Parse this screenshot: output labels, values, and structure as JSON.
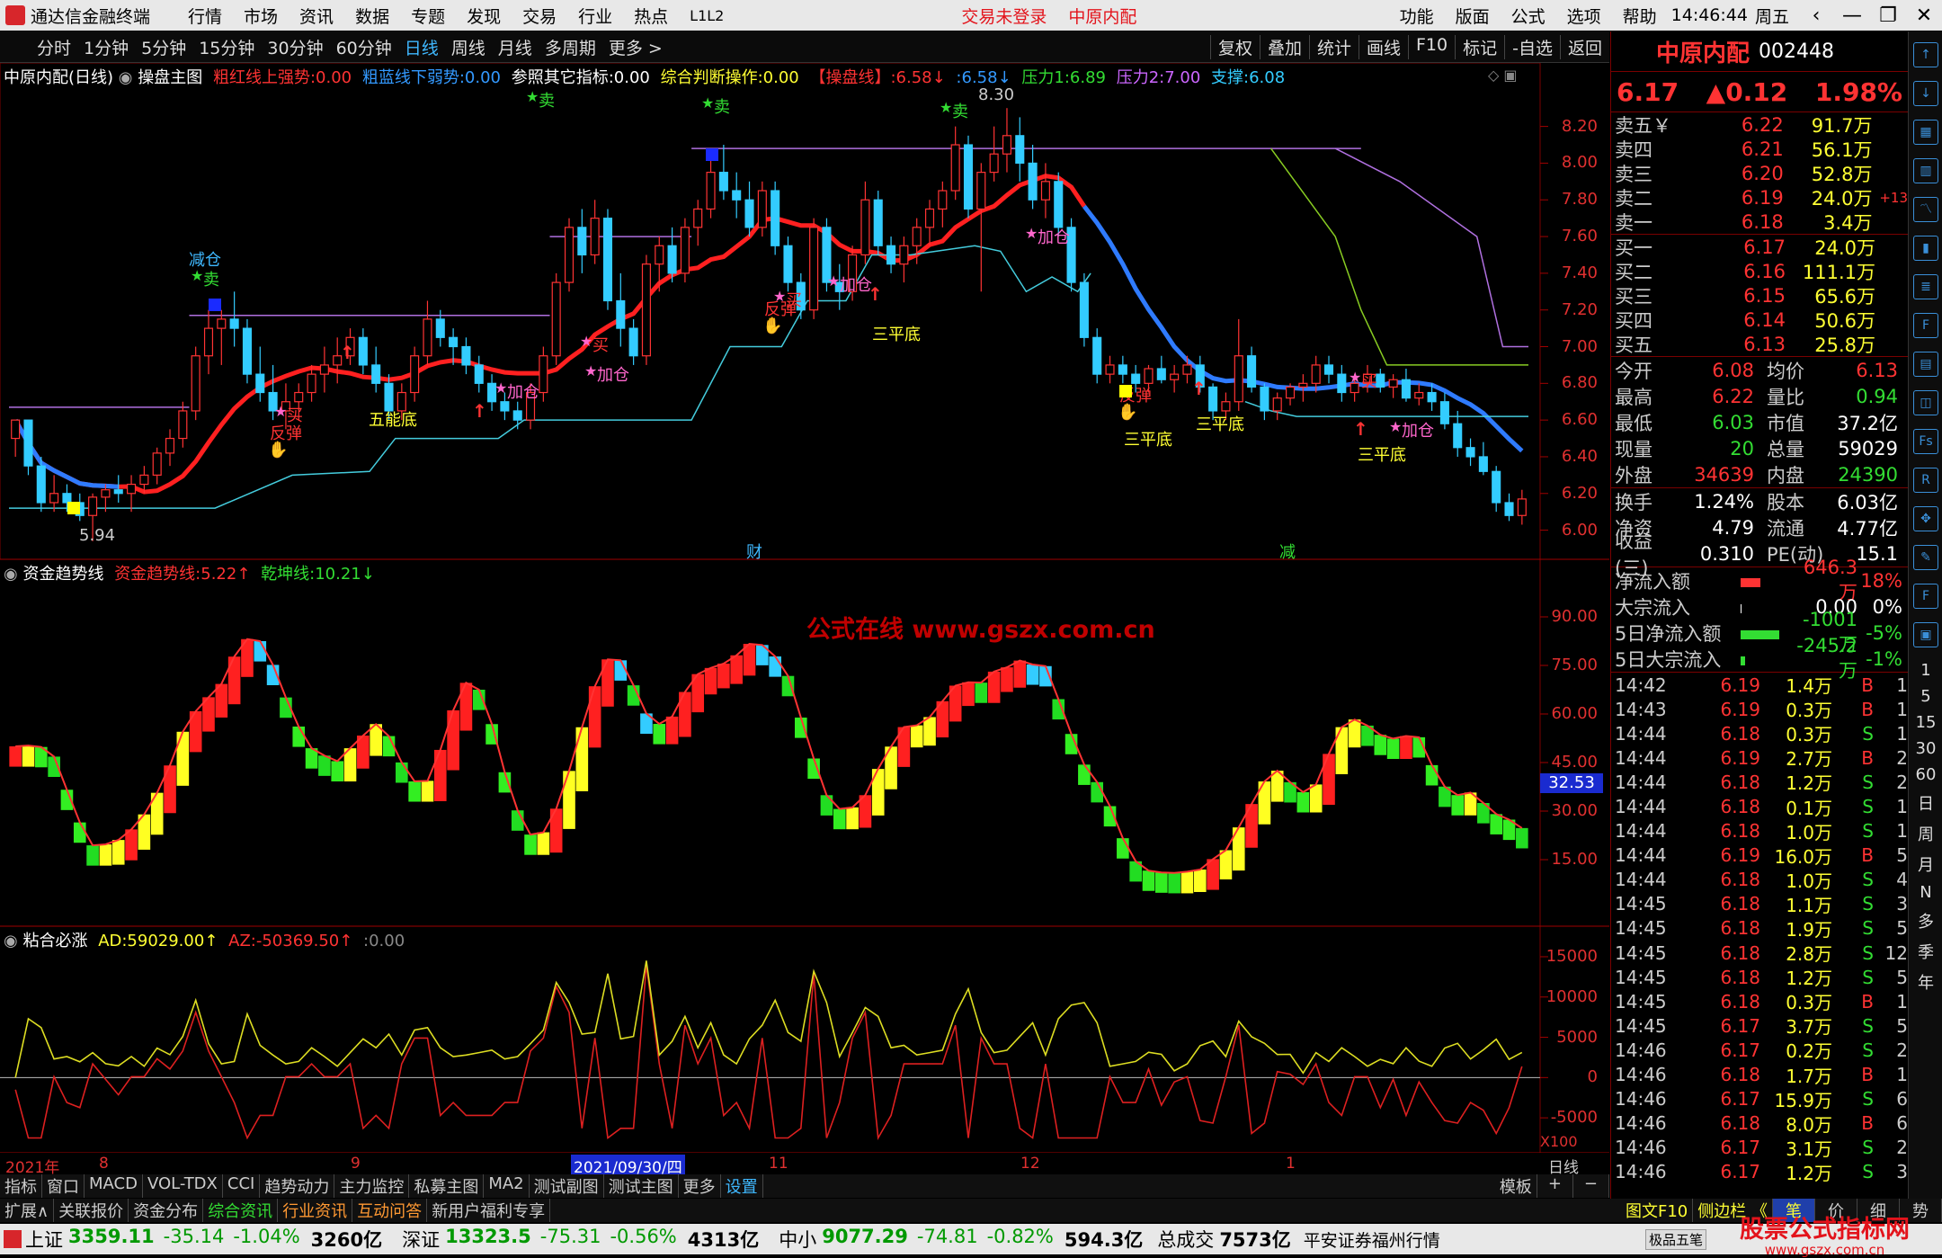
{
  "menubar": {
    "app_title": "通达信金融终端",
    "items": [
      "行情",
      "市场",
      "资讯",
      "数据",
      "专题",
      "发现",
      "交易",
      "行业",
      "热点",
      "L1L2"
    ],
    "trade_status": "交易未登录",
    "stock_name": "中原内配",
    "right_items": [
      "功能",
      "版面",
      "公式",
      "选项",
      "帮助"
    ],
    "time": "14:46:44",
    "weekday": "周五"
  },
  "periodbar": {
    "periods": [
      "分时",
      "1分钟",
      "5分钟",
      "15分钟",
      "30分钟",
      "60分钟",
      "日线",
      "周线",
      "月线",
      "多周期",
      "更多 >"
    ],
    "selected": "日线",
    "tools": [
      "复权",
      "叠加",
      "统计",
      "画线",
      "F10",
      "标记",
      "-自选",
      "返回"
    ]
  },
  "main_legend": {
    "title": "中原内配(日线)",
    "indicator": "操盘主图",
    "items": [
      {
        "label": "粗红线上强势:",
        "value": "0.00",
        "color": "#ff3333"
      },
      {
        "label": "粗蓝线下弱势:",
        "value": "0.00",
        "color": "#3399ff"
      },
      {
        "label": "参照其它指标:",
        "value": "0.00",
        "color": "#ffffff"
      },
      {
        "label": "综合判断操作:",
        "value": "0.00",
        "color": "#ffff33"
      },
      {
        "label": "【操盘线】:",
        "value": "6.58↓",
        "color": "#ff3333"
      },
      {
        "label": ":",
        "value": "6.58↓",
        "color": "#3399ff"
      },
      {
        "label": "压力1:",
        "value": "6.89",
        "color": "#33dd33"
      },
      {
        "label": "压力2:",
        "value": "7.00",
        "color": "#cc66ff"
      },
      {
        "label": "支撑:",
        "value": "6.08",
        "color": "#33ccff"
      }
    ]
  },
  "main_axis": [
    "8.20",
    "8.00",
    "7.80",
    "7.60",
    "7.40",
    "7.20",
    "7.00",
    "6.80",
    "6.60",
    "6.40",
    "6.20",
    "6.00"
  ],
  "annotations": {
    "high": "8.30",
    "low": "5.94",
    "sell": "卖",
    "buy": "买",
    "reduce": "减仓",
    "add": "加仓",
    "rebound": "反弹",
    "triple_bottom": "三平底",
    "wu_bottom": "五能底",
    "cai": "财",
    "jian": "减"
  },
  "sub1": {
    "title": "资金趋势线",
    "items": [
      {
        "label": "资金趋势线:",
        "value": "5.22↑",
        "color": "#ff3333"
      },
      {
        "label": "乾坤线:",
        "value": "10.21↓",
        "color": "#33dd33"
      }
    ],
    "axis": [
      "90.00",
      "75.00",
      "60.00",
      "45.00",
      "30.00",
      "15.00"
    ],
    "current": "32.53",
    "watermark": "公式在线 www.gszx.com.cn"
  },
  "sub2": {
    "title": "粘合必涨",
    "items": [
      {
        "label": "AD:",
        "value": "59029.00↑",
        "color": "#ffff33"
      },
      {
        "label": "AZ:",
        "value": "-50369.50↑",
        "color": "#ff3333"
      },
      {
        "label": ":",
        "value": "0.00",
        "color": "#888888"
      }
    ],
    "axis": [
      "15000",
      "10000",
      "5000",
      "0",
      "-5000"
    ],
    "scale": "X100"
  },
  "time_axis": {
    "labels": [
      "2021年",
      "8",
      "9",
      "2021/09/30/四",
      "11",
      "12",
      "1"
    ],
    "period": "日线"
  },
  "tabs1": {
    "items": [
      "指标",
      "窗口",
      "MACD",
      "VOL-TDX",
      "CCI",
      "趋势动力",
      "主力监控",
      "私募主图",
      "MA2",
      "测试副图",
      "测试主图",
      "更多",
      "设置"
    ],
    "active": "设置",
    "right": [
      "模板",
      "+",
      "−"
    ]
  },
  "tabs2": {
    "items": [
      {
        "label": "扩展∧",
        "color": "w"
      },
      {
        "label": "关联报价",
        "color": "w"
      },
      {
        "label": "资金分布",
        "color": "w"
      },
      {
        "label": "综合资讯",
        "color": "g"
      },
      {
        "label": "行业资讯",
        "color": "o"
      },
      {
        "label": "互动问答",
        "color": "o"
      },
      {
        "label": "新用户福利专享",
        "color": "w"
      }
    ],
    "right": [
      "图文F10",
      "侧边栏 《",
      "笔",
      "价",
      "细",
      "势"
    ]
  },
  "status": {
    "indices": [
      {
        "name": "上证",
        "value": "3359.11",
        "chg": "-35.14",
        "pct": "-1.04%",
        "amt": "3260亿"
      },
      {
        "name": "深证",
        "value": "13323.5",
        "chg": "-75.31",
        "pct": "-0.56%",
        "amt": "4313亿"
      },
      {
        "name": "中小",
        "value": "9077.29",
        "chg": "-74.81",
        "pct": "-0.82%",
        "amt": "594.3亿"
      }
    ],
    "total_label": "总成交",
    "total_value": "7573亿",
    "broker": "平安证券福州行情",
    "badge": "极品五笔",
    "watermark": "股票公式指标网",
    "watermark_url": "www.gszx.com.cn"
  },
  "quote": {
    "name": "中原内配",
    "code": "002448",
    "price": "6.17",
    "change": "▲0.12",
    "pct": "1.98%",
    "asks": [
      {
        "label": "卖五￥",
        "price": "6.22",
        "vol": "91.7万",
        "extra": ""
      },
      {
        "label": "卖四",
        "price": "6.21",
        "vol": "56.1万",
        "extra": ""
      },
      {
        "label": "卖三",
        "price": "6.20",
        "vol": "52.8万",
        "extra": ""
      },
      {
        "label": "卖二",
        "price": "6.19",
        "vol": "24.0万",
        "extra": "+13"
      },
      {
        "label": "卖一",
        "price": "6.18",
        "vol": "3.4万",
        "extra": ""
      }
    ],
    "bids": [
      {
        "label": "买一",
        "price": "6.17",
        "vol": "24.0万"
      },
      {
        "label": "买二",
        "price": "6.16",
        "vol": "111.1万"
      },
      {
        "label": "买三",
        "price": "6.15",
        "vol": "65.6万"
      },
      {
        "label": "买四",
        "price": "6.14",
        "vol": "50.6万"
      },
      {
        "label": "买五",
        "price": "6.13",
        "vol": "25.8万"
      }
    ],
    "stats": [
      {
        "l": "今开",
        "v": "6.08",
        "vc": "up",
        "l2": "均价",
        "v2": "6.13",
        "v2c": "up"
      },
      {
        "l": "最高",
        "v": "6.22",
        "vc": "up",
        "l2": "量比",
        "v2": "0.94",
        "v2c": "dn"
      },
      {
        "l": "最低",
        "v": "6.03",
        "vc": "dn",
        "l2": "市值",
        "v2": "37.2亿",
        "v2c": "w"
      },
      {
        "l": "现量",
        "v": "20",
        "vc": "dn",
        "l2": "总量",
        "v2": "59029",
        "v2c": "w"
      },
      {
        "l": "外盘",
        "v": "34639",
        "vc": "up",
        "l2": "内盘",
        "v2": "24390",
        "v2c": "dn"
      }
    ],
    "stats2": [
      {
        "l": "换手",
        "v": "1.24%",
        "l2": "股本",
        "v2": "6.03亿"
      },
      {
        "l": "净资",
        "v": "4.79",
        "l2": "流通",
        "v2": "4.77亿"
      },
      {
        "l": "收益(三)",
        "v": "0.310",
        "l2": "PE(动)",
        "v2": "15.1"
      }
    ],
    "flows": [
      {
        "l": "净流入额",
        "v": "646.3万",
        "p": "18%",
        "c": "up",
        "bar": 0.45
      },
      {
        "l": "大宗流入",
        "v": "0.00",
        "p": "0%",
        "c": "w",
        "bar": 0.02
      },
      {
        "l": "5日净流入额",
        "v": "-1001万",
        "p": "-5%",
        "c": "dn",
        "bar": 0.9
      },
      {
        "l": "5日大宗流入",
        "v": "-245.2万",
        "p": "-1%",
        "c": "dn",
        "bar": 0.1
      }
    ],
    "ticks": [
      [
        "14:42",
        "6.19",
        "1.4万",
        "B",
        "1"
      ],
      [
        "14:43",
        "6.19",
        "0.3万",
        "B",
        "1"
      ],
      [
        "14:44",
        "6.18",
        "0.3万",
        "S",
        "1"
      ],
      [
        "14:44",
        "6.19",
        "2.7万",
        "B",
        "2"
      ],
      [
        "14:44",
        "6.18",
        "1.2万",
        "S",
        "2"
      ],
      [
        "14:44",
        "6.18",
        "0.1万",
        "S",
        "1"
      ],
      [
        "14:44",
        "6.18",
        "1.0万",
        "S",
        "1"
      ],
      [
        "14:44",
        "6.19",
        "16.0万",
        "B",
        "5"
      ],
      [
        "14:44",
        "6.18",
        "1.0万",
        "S",
        "4"
      ],
      [
        "14:45",
        "6.18",
        "1.1万",
        "S",
        "3"
      ],
      [
        "14:45",
        "6.18",
        "1.9万",
        "S",
        "5"
      ],
      [
        "14:45",
        "6.18",
        "2.8万",
        "S",
        "12"
      ],
      [
        "14:45",
        "6.18",
        "1.2万",
        "S",
        "5"
      ],
      [
        "14:45",
        "6.18",
        "0.3万",
        "B",
        "1"
      ],
      [
        "14:45",
        "6.17",
        "3.7万",
        "S",
        "5"
      ],
      [
        "14:46",
        "6.17",
        "0.2万",
        "S",
        "2"
      ],
      [
        "14:46",
        "6.18",
        "1.7万",
        "B",
        "1"
      ],
      [
        "14:46",
        "6.17",
        "15.9万",
        "S",
        "6"
      ],
      [
        "14:46",
        "6.18",
        "8.0万",
        "B",
        "6"
      ],
      [
        "14:46",
        "6.17",
        "3.1万",
        "S",
        "2"
      ],
      [
        "14:46",
        "6.17",
        "1.2万",
        "S",
        "3"
      ]
    ]
  },
  "side_icons": [
    "arrow-up-icon",
    "arrow-down-icon",
    "grid-icon",
    "bars-icon",
    "line-icon",
    "candle-icon",
    "list-icon",
    "f10-icon",
    "news-icon",
    "chip-icon",
    "fs-icon",
    "rsi-icon",
    "move-icon",
    "pen-icon",
    "fs2-icon",
    "box-icon"
  ],
  "side_text": [
    "1",
    "5",
    "15",
    "30",
    "60",
    "日",
    "周",
    "月",
    "N",
    "多",
    "季",
    "年"
  ],
  "colors": {
    "up": "#ff3333",
    "down": "#33ccff",
    "ma_red": "#ff2020",
    "ma_blue": "#2f7bff",
    "bg": "#000000",
    "grid": "#7a0000"
  },
  "chart_data": {
    "type": "candlestick",
    "dates_note": "2021年7月–2022年1月 日线",
    "ylim": [
      5.9,
      8.35
    ],
    "candles": [
      [
        6.5,
        6.6,
        6.4,
        6.6
      ],
      [
        6.6,
        6.6,
        6.3,
        6.35
      ],
      [
        6.35,
        6.4,
        6.1,
        6.15
      ],
      [
        6.15,
        6.3,
        6.1,
        6.2
      ],
      [
        6.2,
        6.25,
        6.1,
        6.15
      ],
      [
        6.15,
        6.2,
        6.05,
        6.08
      ],
      [
        6.08,
        6.2,
        5.94,
        6.18
      ],
      [
        6.18,
        6.25,
        6.1,
        6.22
      ],
      [
        6.22,
        6.3,
        6.15,
        6.2
      ],
      [
        6.2,
        6.3,
        6.1,
        6.25
      ],
      [
        6.25,
        6.35,
        6.2,
        6.3
      ],
      [
        6.3,
        6.45,
        6.25,
        6.42
      ],
      [
        6.42,
        6.55,
        6.35,
        6.5
      ],
      [
        6.5,
        6.7,
        6.45,
        6.65
      ],
      [
        6.65,
        7.0,
        6.6,
        6.95
      ],
      [
        6.95,
        7.2,
        6.85,
        7.1
      ],
      [
        7.1,
        7.2,
        6.9,
        7.15
      ],
      [
        7.15,
        7.3,
        7.0,
        7.1
      ],
      [
        7.1,
        7.15,
        6.8,
        6.85
      ],
      [
        6.85,
        7.0,
        6.7,
        6.75
      ],
      [
        6.75,
        6.9,
        6.6,
        6.65
      ],
      [
        6.65,
        6.8,
        6.55,
        6.7
      ],
      [
        6.7,
        6.8,
        6.6,
        6.75
      ],
      [
        6.75,
        6.9,
        6.7,
        6.85
      ],
      [
        6.85,
        7.0,
        6.75,
        6.9
      ],
      [
        6.9,
        7.05,
        6.8,
        6.95
      ],
      [
        6.95,
        7.1,
        6.9,
        7.05
      ],
      [
        7.05,
        7.1,
        6.85,
        6.9
      ],
      [
        6.9,
        7.0,
        6.75,
        6.8
      ],
      [
        6.8,
        6.85,
        6.6,
        6.65
      ],
      [
        6.65,
        6.8,
        6.6,
        6.75
      ],
      [
        6.75,
        7.0,
        6.7,
        6.95
      ],
      [
        6.95,
        7.25,
        6.9,
        7.15
      ],
      [
        7.15,
        7.2,
        7.0,
        7.05
      ],
      [
        7.05,
        7.1,
        6.9,
        7.0
      ],
      [
        7.0,
        7.05,
        6.85,
        6.9
      ],
      [
        6.9,
        6.95,
        6.75,
        6.8
      ],
      [
        6.8,
        6.85,
        6.65,
        6.7
      ],
      [
        6.7,
        6.75,
        6.6,
        6.65
      ],
      [
        6.65,
        6.7,
        6.55,
        6.6
      ],
      [
        6.6,
        6.8,
        6.55,
        6.75
      ],
      [
        6.75,
        7.0,
        6.7,
        6.95
      ],
      [
        6.95,
        7.4,
        6.9,
        7.35
      ],
      [
        7.35,
        7.7,
        7.3,
        7.65
      ],
      [
        7.65,
        7.75,
        7.4,
        7.5
      ],
      [
        7.5,
        7.8,
        7.45,
        7.7
      ],
      [
        7.7,
        7.75,
        7.2,
        7.25
      ],
      [
        7.25,
        7.4,
        7.0,
        7.1
      ],
      [
        7.1,
        7.15,
        6.9,
        6.95
      ],
      [
        6.95,
        7.5,
        6.9,
        7.45
      ],
      [
        7.45,
        7.6,
        7.3,
        7.55
      ],
      [
        7.55,
        7.65,
        7.35,
        7.4
      ],
      [
        7.4,
        7.7,
        7.35,
        7.65
      ],
      [
        7.65,
        7.8,
        7.55,
        7.75
      ],
      [
        7.75,
        8.05,
        7.7,
        7.95
      ],
      [
        7.95,
        8.1,
        7.8,
        7.85
      ],
      [
        7.85,
        7.95,
        7.7,
        7.8
      ],
      [
        7.8,
        7.9,
        7.6,
        7.65
      ],
      [
        7.65,
        7.9,
        7.6,
        7.85
      ],
      [
        7.85,
        7.9,
        7.5,
        7.55
      ],
      [
        7.55,
        7.6,
        7.3,
        7.35
      ],
      [
        7.35,
        7.4,
        7.15,
        7.2
      ],
      [
        7.2,
        7.7,
        7.15,
        7.65
      ],
      [
        7.65,
        7.7,
        7.3,
        7.35
      ],
      [
        7.35,
        7.45,
        7.2,
        7.3
      ],
      [
        7.3,
        7.55,
        7.25,
        7.5
      ],
      [
        7.5,
        7.9,
        7.45,
        7.8
      ],
      [
        7.8,
        7.85,
        7.5,
        7.55
      ],
      [
        7.55,
        7.6,
        7.4,
        7.45
      ],
      [
        7.45,
        7.6,
        7.35,
        7.55
      ],
      [
        7.55,
        7.7,
        7.45,
        7.65
      ],
      [
        7.65,
        7.8,
        7.55,
        7.75
      ],
      [
        7.75,
        7.9,
        7.65,
        7.85
      ],
      [
        7.85,
        8.2,
        7.8,
        8.1
      ],
      [
        8.1,
        8.15,
        7.7,
        7.75
      ],
      [
        7.75,
        8.0,
        7.3,
        7.95
      ],
      [
        7.95,
        8.2,
        7.9,
        8.05
      ],
      [
        8.05,
        8.3,
        7.95,
        8.15
      ],
      [
        8.15,
        8.25,
        7.9,
        8.0
      ],
      [
        8.0,
        8.1,
        7.75,
        7.8
      ],
      [
        7.8,
        8.0,
        7.7,
        7.9
      ],
      [
        7.9,
        7.95,
        7.6,
        7.65
      ],
      [
        7.65,
        7.7,
        7.3,
        7.35
      ],
      [
        7.35,
        7.4,
        7.0,
        7.05
      ],
      [
        7.05,
        7.1,
        6.8,
        6.85
      ],
      [
        6.85,
        6.95,
        6.8,
        6.9
      ],
      [
        6.9,
        6.95,
        6.8,
        6.85
      ],
      [
        6.85,
        6.9,
        6.75,
        6.8
      ],
      [
        6.8,
        6.9,
        6.75,
        6.88
      ],
      [
        6.88,
        6.95,
        6.8,
        6.82
      ],
      [
        6.82,
        6.9,
        6.75,
        6.85
      ],
      [
        6.85,
        6.95,
        6.8,
        6.9
      ],
      [
        6.9,
        6.95,
        6.75,
        6.78
      ],
      [
        6.78,
        6.8,
        6.6,
        6.65
      ],
      [
        6.65,
        6.75,
        6.6,
        6.7
      ],
      [
        6.7,
        7.15,
        6.65,
        6.95
      ],
      [
        6.95,
        7.0,
        6.75,
        6.78
      ],
      [
        6.78,
        6.8,
        6.6,
        6.65
      ],
      [
        6.65,
        6.75,
        6.6,
        6.72
      ],
      [
        6.72,
        6.8,
        6.68,
        6.78
      ],
      [
        6.78,
        6.85,
        6.7,
        6.8
      ],
      [
        6.8,
        6.95,
        6.75,
        6.9
      ],
      [
        6.9,
        6.95,
        6.8,
        6.85
      ],
      [
        6.85,
        6.9,
        6.7,
        6.75
      ],
      [
        6.75,
        6.85,
        6.7,
        6.8
      ],
      [
        6.8,
        6.9,
        6.75,
        6.85
      ],
      [
        6.85,
        6.88,
        6.75,
        6.78
      ],
      [
        6.78,
        6.85,
        6.72,
        6.82
      ],
      [
        6.82,
        6.88,
        6.7,
        6.72
      ],
      [
        6.72,
        6.8,
        6.68,
        6.75
      ],
      [
        6.75,
        6.8,
        6.65,
        6.7
      ],
      [
        6.7,
        6.75,
        6.55,
        6.58
      ],
      [
        6.58,
        6.65,
        6.4,
        6.45
      ],
      [
        6.45,
        6.5,
        6.35,
        6.4
      ],
      [
        6.4,
        6.48,
        6.3,
        6.32
      ],
      [
        6.32,
        6.35,
        6.1,
        6.15
      ],
      [
        6.15,
        6.2,
        6.05,
        6.08
      ],
      [
        6.08,
        6.22,
        6.03,
        6.17
      ]
    ],
    "ma_red_last": "6.58",
    "ma_blue_last": "6.58",
    "pressure1": "6.89",
    "pressure2": "7.00",
    "support": "6.08"
  }
}
